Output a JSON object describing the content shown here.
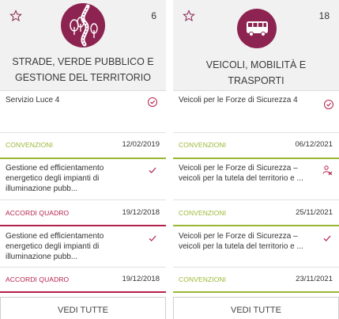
{
  "columns": [
    {
      "category": {
        "count": "6",
        "title": "STRADE, VERDE PUBBLICO E GESTIONE DEL TERRITORIO",
        "icon": "road-trees-icon",
        "color": "#8c2350"
      },
      "cards": [
        {
          "title": "Servizio Luce 4",
          "tag": "CONVENZIONI",
          "tag_color": "#9ab733",
          "date": "12/02/2019",
          "status_icon": "check-circle-icon"
        },
        {
          "title": "Gestione ed efficientamento energetico degli impianti di illuminazione pubb...",
          "tag": "ACCORDI QUADRO",
          "tag_color": "#b5204b",
          "date": "19/12/2018",
          "status_icon": "check-icon"
        },
        {
          "title": "Gestione ed efficientamento energetico degli impianti di illuminazione pubb...",
          "tag": "ACCORDI QUADRO",
          "tag_color": "#b5204b",
          "date": "19/12/2018",
          "status_icon": "check-icon"
        }
      ],
      "see_all": "VEDI TUTTE"
    },
    {
      "category": {
        "count": "18",
        "title": "VEICOLI, MOBILITÀ E TRASPORTI",
        "icon": "bus-icon",
        "color": "#8c2350"
      },
      "cards": [
        {
          "title": "Veicoli per le Forze di Sicurezza 4",
          "tag": "CONVENZIONI",
          "tag_color": "#9ab733",
          "date": "06/12/2021",
          "status_icon": "check-circle-icon"
        },
        {
          "title": "Veicoli per le Forze di Sicurezza – veicoli per la tutela del territorio e ...",
          "tag": "CONVENZIONI",
          "tag_color": "#9ab733",
          "date": "25/11/2021",
          "status_icon": "user-tools-icon"
        },
        {
          "title": "Veicoli per le Forze di Sicurezza – veicoli per la tutela del territorio e ...",
          "tag": "CONVENZIONI",
          "tag_color": "#9ab733",
          "date": "23/11/2021",
          "status_icon": "check-icon"
        }
      ],
      "see_all": "VEDI TUTTE"
    }
  ]
}
